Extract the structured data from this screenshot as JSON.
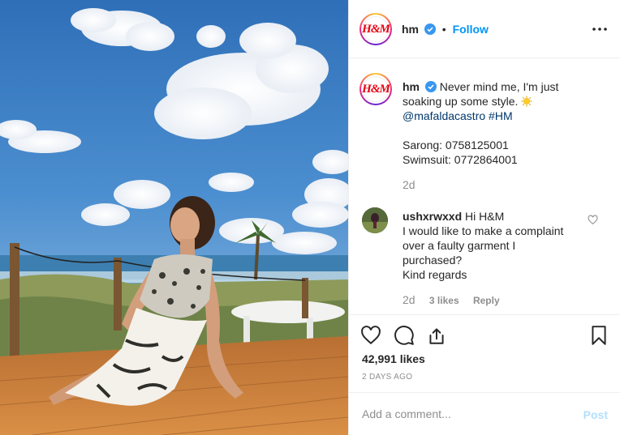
{
  "post": {
    "image_alt": "Woman in a sarong and swimsuit sitting on a wooden deck by the sea"
  },
  "header": {
    "avatar_text": "H&M",
    "username": "hm",
    "separator": "•",
    "follow_label": "Follow",
    "more_icon": "more-horizontal-icon"
  },
  "caption": {
    "username": "hm",
    "text": "Never mind me, I'm just",
    "text_line2": "soaking up some style.",
    "emoji_icon": "sun-emoji-icon",
    "mention": "@mafaldacastro",
    "hashtag": "#HM",
    "sarong": "Sarong: 0758125001",
    "swimsuit": "Swimsuit: 0772864001",
    "time": "2d"
  },
  "comment": {
    "username": "ushxrwxxd",
    "line1": "Hi H&M",
    "line2": "I would like to make a complaint",
    "line3": "over a faulty garment I",
    "line4": "purchased?",
    "line5": "Kind regards",
    "time": "2d",
    "likes": "3 likes",
    "reply": "Reply"
  },
  "actions": {
    "like_icon": "heart-icon",
    "comment_icon": "comment-icon",
    "share_icon": "share-icon",
    "save_icon": "bookmark-icon",
    "likes": "42,991 likes",
    "date": "2 DAYS AGO"
  },
  "add_comment": {
    "placeholder": "Add a comment...",
    "post_label": "Post"
  },
  "colors": {
    "link": "#00376b",
    "follow": "#0095f6",
    "muted": "#8e8e8e",
    "post_disabled": "#b2dffc",
    "brand_red": "#e50010"
  }
}
